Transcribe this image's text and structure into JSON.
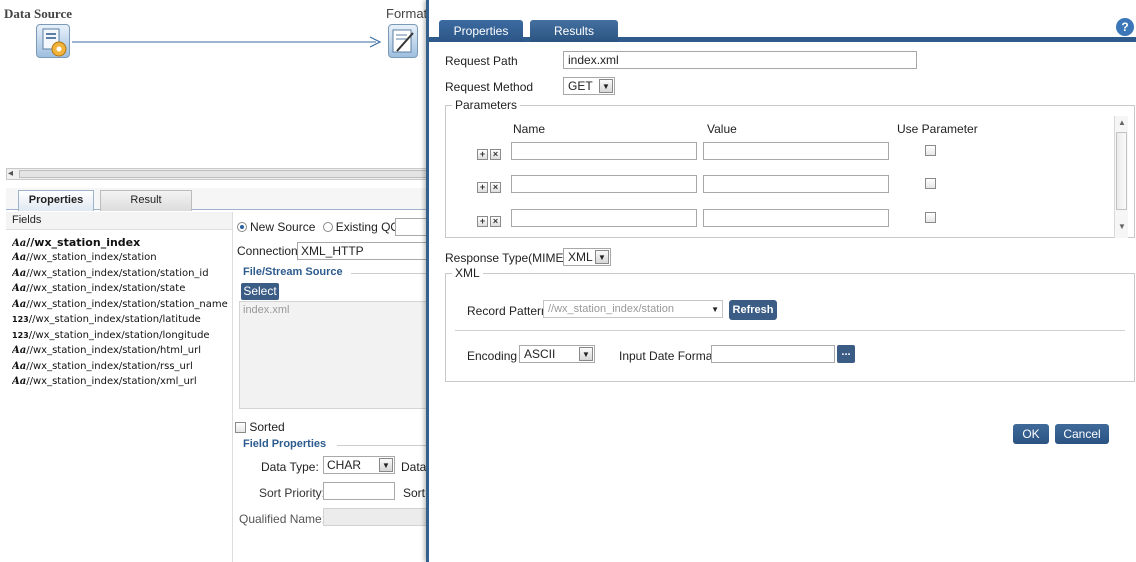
{
  "background": {
    "canvas": {
      "node1_title": "Data Source",
      "node2_title": "Format"
    },
    "tabs": {
      "properties": "Properties",
      "result": "Result"
    },
    "fields_header": "Fields",
    "fields": [
      {
        "type": "Aa",
        "path": "//wx_station_index"
      },
      {
        "type": "Aa",
        "path": "//wx_station_index/station"
      },
      {
        "type": "Aa",
        "path": "//wx_station_index/station/station_id"
      },
      {
        "type": "Aa",
        "path": "//wx_station_index/station/state"
      },
      {
        "type": "Aa",
        "path": "//wx_station_index/station/station_name"
      },
      {
        "type": "123",
        "path": "//wx_station_index/station/latitude"
      },
      {
        "type": "123",
        "path": "//wx_station_index/station/longitude"
      },
      {
        "type": "Aa",
        "path": "//wx_station_index/station/html_url"
      },
      {
        "type": "Aa",
        "path": "//wx_station_index/station/rss_url"
      },
      {
        "type": "Aa",
        "path": "//wx_station_index/station/xml_url"
      }
    ],
    "source": {
      "new_source": "New Source",
      "existing_qo": "Existing QO",
      "connection_label": "Connection:",
      "connection_value": "XML_HTTP",
      "file_stream_legend": "File/Stream Source",
      "select_btn": "Select",
      "file_value": "index.xml",
      "sorted_label": "Sorted",
      "field_props_legend": "Field Properties",
      "data_type_label": "Data Type:",
      "data_type_value": "CHAR",
      "data_type_label2": "Data",
      "sort_priority_label": "Sort Priority:",
      "sort_label2": "Sort",
      "qualified_name_label": "Qualified Name:"
    }
  },
  "dialog": {
    "tabs": {
      "properties": "Properties",
      "results": "Results"
    },
    "help": "?",
    "request_path_label": "Request Path",
    "request_path_value": "index.xml",
    "request_method_label": "Request Method",
    "request_method_value": "GET",
    "parameters": {
      "legend": "Parameters",
      "col_name": "Name",
      "col_value": "Value",
      "col_use": "Use Parameter",
      "rows": [
        {
          "name": "",
          "value": "",
          "use": false
        },
        {
          "name": "",
          "value": "",
          "use": false
        },
        {
          "name": "",
          "value": "",
          "use": false
        }
      ]
    },
    "response_type_label": "Response Type(MIME)",
    "response_type_value": "XML",
    "xml": {
      "legend": "XML",
      "record_pattern_label": "Record Pattern",
      "record_pattern_value": "//wx_station_index/station",
      "refresh_btn": "Refresh",
      "encoding_label": "Encoding",
      "encoding_value": "ASCII",
      "input_date_format_label": "Input Date Format",
      "input_date_format_value": "",
      "browse_btn": "..."
    },
    "ok_btn": "OK",
    "cancel_btn": "Cancel"
  }
}
